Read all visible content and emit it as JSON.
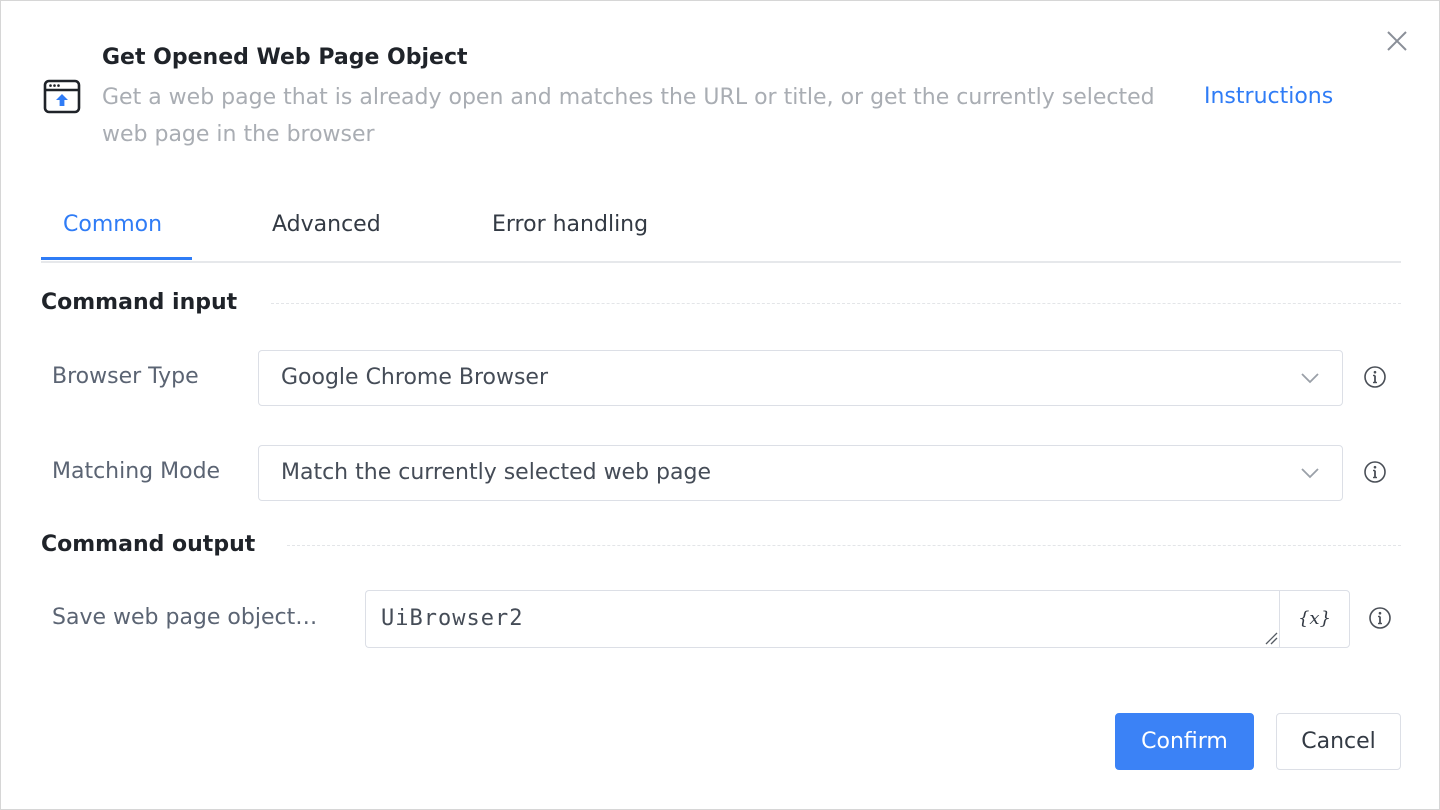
{
  "dialog": {
    "title": "Get Opened Web Page Object",
    "description": "Get a web page that is already open and matches the URL or title, or get the currently selected web page in the browser",
    "instructions_label": "Instructions",
    "close_icon": "close-icon",
    "header_icon": "browser-window-upload-icon"
  },
  "tabs": [
    {
      "label": "Common",
      "active": true
    },
    {
      "label": "Advanced",
      "active": false
    },
    {
      "label": "Error handling",
      "active": false
    }
  ],
  "sections": {
    "input_title": "Command input",
    "output_title": "Command output"
  },
  "fields": {
    "browser_type": {
      "label": "Browser Type",
      "value": "Google Chrome Browser"
    },
    "matching_mode": {
      "label": "Matching Mode",
      "value": "Match the currently selected web page"
    },
    "save_object": {
      "label": "Save web page object…",
      "value": "UiBrowser2",
      "var_button": "{x}"
    }
  },
  "buttons": {
    "confirm": "Confirm",
    "cancel": "Cancel"
  },
  "colors": {
    "accent": "#2f7cf6",
    "primary_button": "#3b82f6",
    "muted_text": "#a9adb3"
  }
}
